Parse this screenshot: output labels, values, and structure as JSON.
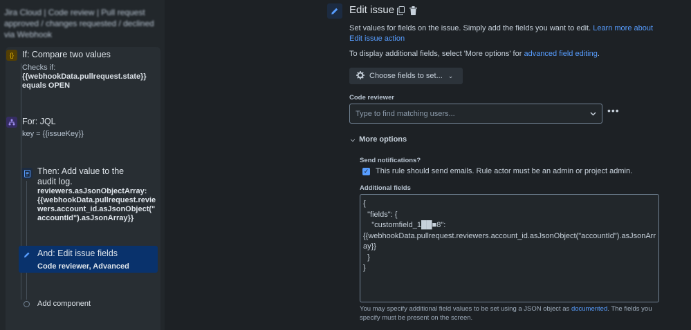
{
  "left": {
    "header_blurred": "Jira Cloud | Code review | Pull request approved / changes requested / declined via Webhook",
    "steps": [
      {
        "title": "If: Compare two values",
        "lines": [
          "Checks if:",
          "{{webhookData.pullrequest.state}}",
          "equals OPEN"
        ],
        "icon": "condition-icon"
      },
      {
        "title": "For: JQL",
        "lines": [
          "key = {{issueKey}}"
        ],
        "icon": "branch-icon"
      },
      {
        "title": "Then: Add value to the",
        "title2": "audit log.",
        "lines": [
          "reviewers.asJsonObjectArray:",
          "{{webhookData.pullrequest.revie",
          "wers.account_id.asJsonObject(\"",
          "accountId\").asJsonArray}}"
        ],
        "icon": "audit-log-icon"
      },
      {
        "title": "And: Edit issue fields",
        "lines": [
          "Code reviewer, Advanced"
        ],
        "icon": "pencil-icon"
      }
    ],
    "add_component": "Add component"
  },
  "main": {
    "title": "Edit issue",
    "desc1": "Set values for fields on the issue. Simply add the fields you want to edit. ",
    "desc1_link": "Learn more about Edit issue action",
    "desc2": "To display additional fields, select 'More options' for ",
    "desc2_link": "advanced field editing",
    "desc2_end": ".",
    "choose_btn": "Choose fields to set...",
    "code_reviewer_label": "Code reviewer",
    "code_reviewer_placeholder": "Type to find matching users...",
    "more_options": "More options",
    "send_notifications_label": "Send notifications?",
    "send_notifications_text": "This rule should send emails. Rule actor must be an admin or project admin.",
    "additional_fields_label": "Additional fields",
    "additional_fields_value": "{\n  \"fields\": {\n    \"customfield_1██■8\": \n{{webhookData.pullrequest.reviewers.account_id.asJsonObject(\"accountId\").asJsonArray}}\n  }\n}",
    "help_text1": "You may specify additional field values to be set using a JSON object as ",
    "help_link": "documented",
    "help_text2": ". The fields you specify must be present on the screen."
  },
  "colors": {
    "background": "#1d2125",
    "accent": "#579dff",
    "selected_step": "#09326c"
  }
}
